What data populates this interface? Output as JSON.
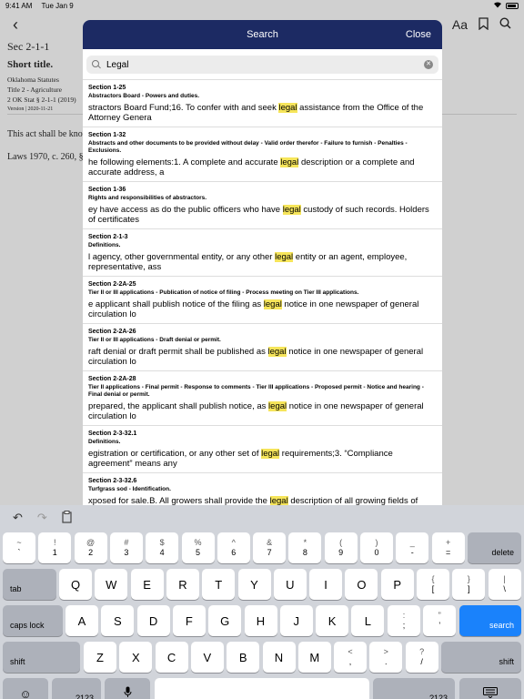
{
  "status": {
    "time": "9:41 AM",
    "date": "Tue Jan 9"
  },
  "background": {
    "title_partial": "Sec 2-1-1",
    "section": "Sec 2-1-1",
    "short_title": "Short title.",
    "meta1": "Oklahoma Statutes",
    "meta2": "Title 2 - Agriculture",
    "meta3": "2 OK Stat § 2-1-1 (2019)",
    "meta4": "Version | 2020-11-21",
    "body": "This act shall be kno",
    "laws": "Laws 1970, c. 260, §",
    "font_button": "Aa"
  },
  "modal": {
    "title": "Search",
    "close": "Close",
    "search_value": "Legal",
    "results": [
      {
        "section": "Section 1-25",
        "heading": "Abstractors Board - Powers and duties.",
        "pre": "stractors Board Fund;16.  To confer with and seek ",
        "hl": "legal",
        "post": " assistance from the Office of the Attorney Genera"
      },
      {
        "section": "Section 1-32",
        "heading": "Abstracts and other documents to be provided without delay - Valid order therefor - Failure to furnish - Penalties - Exclusions.",
        "pre": "he following elements:1.  A complete and accurate ",
        "hl": "legal",
        "post": " description or a complete and accurate address, a"
      },
      {
        "section": "Section 1-36",
        "heading": "Rights and responsibilities of abstractors.",
        "pre": "ey have access as do the public officers who have ",
        "hl": "legal",
        "post": " custody of such records. Holders of certificates"
      },
      {
        "section": "Section 2-1-3",
        "heading": "Definitions.",
        "pre": "l agency, other governmental entity, or any other ",
        "hl": "legal",
        "post": " entity or an agent, employee, representative, ass"
      },
      {
        "section": "Section 2-2A-25",
        "heading": "Tier II or III applications - Publication of notice of filing - Process meeting on Tier III applications.",
        "pre": "e applicant shall publish notice of the filing as ",
        "hl": "legal",
        "post": " notice in one newspaper of general circulation lo"
      },
      {
        "section": "Section 2-2A-26",
        "heading": "Tier II or III applications - Draft denial or permit.",
        "pre": "raft denial or draft permit shall be published as ",
        "hl": "legal",
        "post": " notice in one newspaper of general circulation lo"
      },
      {
        "section": "Section 2-2A-28",
        "heading": "Tier II applications - Final permit - Response to comments - Tier III applications - Proposed permit - Notice and hearing - Final denial or permit.",
        "pre": " prepared, the applicant shall publish notice, as ",
        "hl": "legal",
        "post": " notice in one newspaper of general circulation lo"
      },
      {
        "section": "Section 2-3-32.1",
        "heading": "Definitions.",
        "pre": "egistration or certification, or any other set of ",
        "hl": "legal",
        "post": " requirements;3.  “Compliance agreement” means any"
      },
      {
        "section": "Section 2-3-32.6",
        "heading": "Turfgrass sod - Identification.",
        "pre": "xposed for sale.B.  All growers shall provide the ",
        "hl": "legal",
        "post": " description of all growing fields of"
      }
    ]
  },
  "keyboard": {
    "row1": [
      {
        "top": "~",
        "bot": "`"
      },
      {
        "top": "!",
        "bot": "1"
      },
      {
        "top": "@",
        "bot": "2"
      },
      {
        "top": "#",
        "bot": "3"
      },
      {
        "top": "$",
        "bot": "4"
      },
      {
        "top": "%",
        "bot": "5"
      },
      {
        "top": "^",
        "bot": "6"
      },
      {
        "top": "&",
        "bot": "7"
      },
      {
        "top": "*",
        "bot": "8"
      },
      {
        "top": "(",
        "bot": "9"
      },
      {
        "top": ")",
        "bot": "0"
      },
      {
        "top": "_",
        "bot": "-"
      },
      {
        "top": "+",
        "bot": "="
      }
    ],
    "delete": "delete",
    "tab": "tab",
    "row2": [
      "Q",
      "W",
      "E",
      "R",
      "T",
      "Y",
      "U",
      "I",
      "O",
      "P"
    ],
    "row2_extra": [
      {
        "top": "{",
        "bot": "["
      },
      {
        "top": "}",
        "bot": "]"
      },
      {
        "top": "|",
        "bot": "\\"
      }
    ],
    "caps": "caps lock",
    "row3": [
      "A",
      "S",
      "D",
      "F",
      "G",
      "H",
      "J",
      "K",
      "L"
    ],
    "row3_extra": [
      {
        "top": ":",
        "bot": ";"
      },
      {
        "top": "”",
        "bot": "’"
      }
    ],
    "search": "search",
    "shift": "shift",
    "row4": [
      "Z",
      "X",
      "C",
      "V",
      "B",
      "N",
      "M"
    ],
    "row4_extra": [
      {
        "top": "<",
        "bot": ","
      },
      {
        "top": ">",
        "bot": "."
      },
      {
        "top": "?",
        "bot": "/"
      }
    ],
    "numbers": ".?123"
  }
}
